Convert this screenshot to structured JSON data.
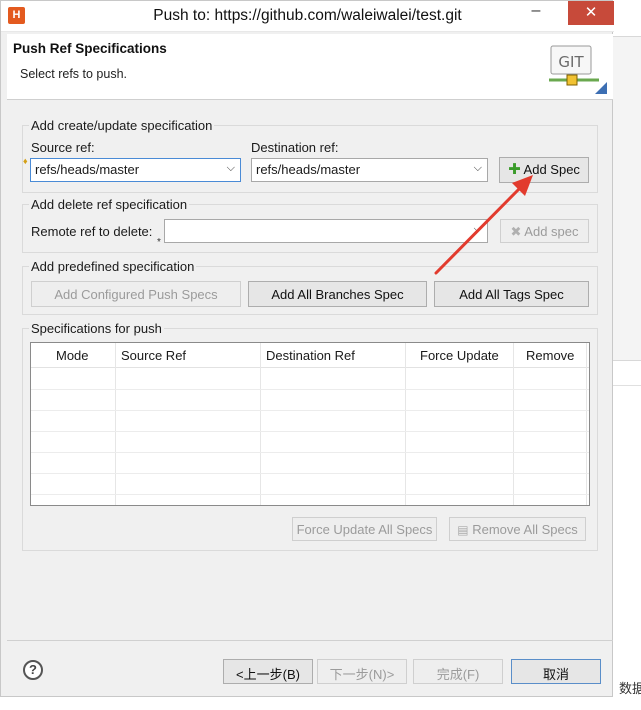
{
  "window": {
    "title": "Push to: https://github.com/waleiwalei/test.git",
    "app_icon": "H",
    "close_glyph": "✕",
    "min_glyph": "–"
  },
  "header": {
    "title": "Push Ref Specifications",
    "subtitle": "Select refs to push.",
    "logo_text": "GIT"
  },
  "create_group": {
    "label": "Add create/update specification",
    "source_label": "Source ref:",
    "source_value": "refs/heads/master",
    "dest_label": "Destination ref:",
    "dest_value": "refs/heads/master",
    "add_button": "Add Spec",
    "add_icon": "plus-icon"
  },
  "delete_group": {
    "label": "Add delete ref specification",
    "remote_label": "Remote ref to delete:",
    "remote_value": "",
    "add_button": "Add spec",
    "add_icon": "delete-x-icon"
  },
  "predefined_group": {
    "label": "Add predefined specification",
    "configured_button": "Add Configured Push Specs",
    "branches_button": "Add All Branches Spec",
    "tags_button": "Add All Tags Spec"
  },
  "specs_group": {
    "label": "Specifications for push",
    "columns": [
      "Mode",
      "Source Ref",
      "Destination Ref",
      "Force Update",
      "Remove"
    ],
    "rows": [],
    "force_all_button": "Force Update All Specs",
    "remove_all_button": "Remove All Specs"
  },
  "footer": {
    "help_glyph": "?",
    "back_button": "<上一步(B)",
    "next_button": "下一步(N)>",
    "finish_button": "完成(F)",
    "cancel_button": "取消"
  },
  "background_text": "数据",
  "colors": {
    "arrow": "#e23b2e",
    "close_button": "#c74a3a",
    "plus_icon": "#3a9b2a",
    "dialog_bg": "#f0f0f0"
  }
}
